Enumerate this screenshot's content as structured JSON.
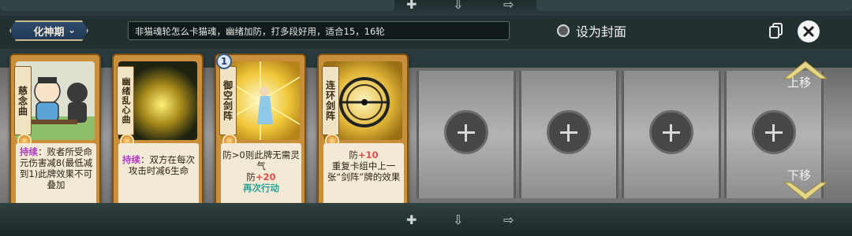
{
  "header": {
    "rank_label": "化神期",
    "deck_description": "非猫魂轮怎么卡猫魂，幽绪加防，打多段好用，适合15，16轮",
    "cover_label": "设为封面"
  },
  "cards": [
    {
      "name": "慈念曲",
      "keyword": "持续",
      "desc_parts": [
        "：败者所受命元伤害减8(最低减到1)此牌效果不可叠加"
      ]
    },
    {
      "name": "幽绪乱心曲",
      "keyword": "持续",
      "desc_parts": [
        "：双方在每次攻击时减6生命"
      ]
    },
    {
      "name": "御空剑阵",
      "cost": "1",
      "line1": "防>0则此牌无需灵气",
      "line2_prefix": "防",
      "line2_value": "+20",
      "line3": "再次行动"
    },
    {
      "name": "连环剑阵",
      "line1_prefix": "防",
      "line1_value": "+10",
      "line2": "重复卡组中上一张“剑阵”牌的效果"
    }
  ],
  "side": {
    "move_up": "上移",
    "move_down": "下移"
  },
  "colors": {
    "card_frame": "#c98f3b",
    "keyword_purple": "#b23cc4",
    "keyword_red": "#e04a4a",
    "keyword_teal": "#2aa196"
  }
}
